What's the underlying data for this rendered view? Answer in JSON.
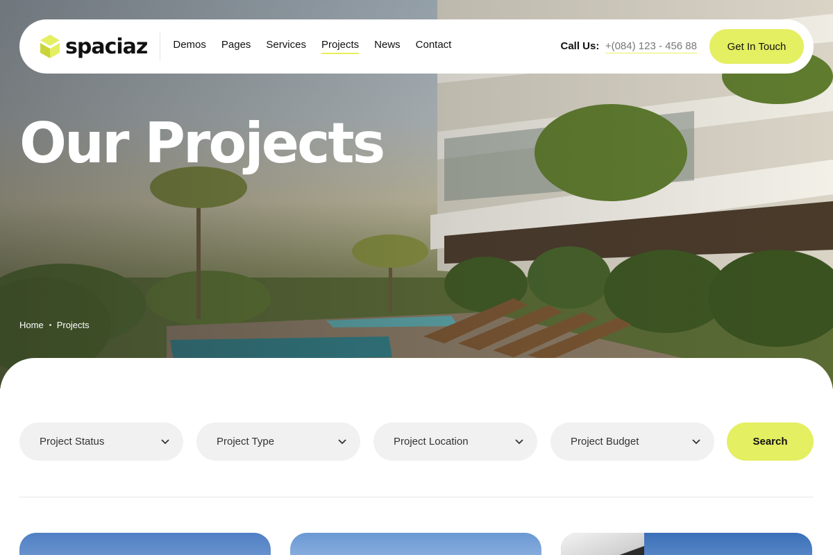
{
  "brand": {
    "name": "spaciaz",
    "accent": "#e4ef61"
  },
  "nav": {
    "items": [
      {
        "label": "Demos",
        "active": false
      },
      {
        "label": "Pages",
        "active": false
      },
      {
        "label": "Services",
        "active": false
      },
      {
        "label": "Projects",
        "active": true
      },
      {
        "label": "News",
        "active": false
      },
      {
        "label": "Contact",
        "active": false
      }
    ],
    "call_label": "Call Us:",
    "call_number": "+(084) 123 - 456 88",
    "cta_label": "Get In Touch"
  },
  "hero": {
    "title": "Our Projects",
    "breadcrumb": [
      "Home",
      "Projects"
    ]
  },
  "filters": {
    "items": [
      {
        "label": "Project Status",
        "icon": "chevron-down-icon"
      },
      {
        "label": "Project Type",
        "icon": "chevron-down-icon"
      },
      {
        "label": "Project Location",
        "icon": "chevron-down-icon"
      },
      {
        "label": "Project Budget",
        "icon": "chevron-down-icon"
      }
    ],
    "search_label": "Search"
  }
}
